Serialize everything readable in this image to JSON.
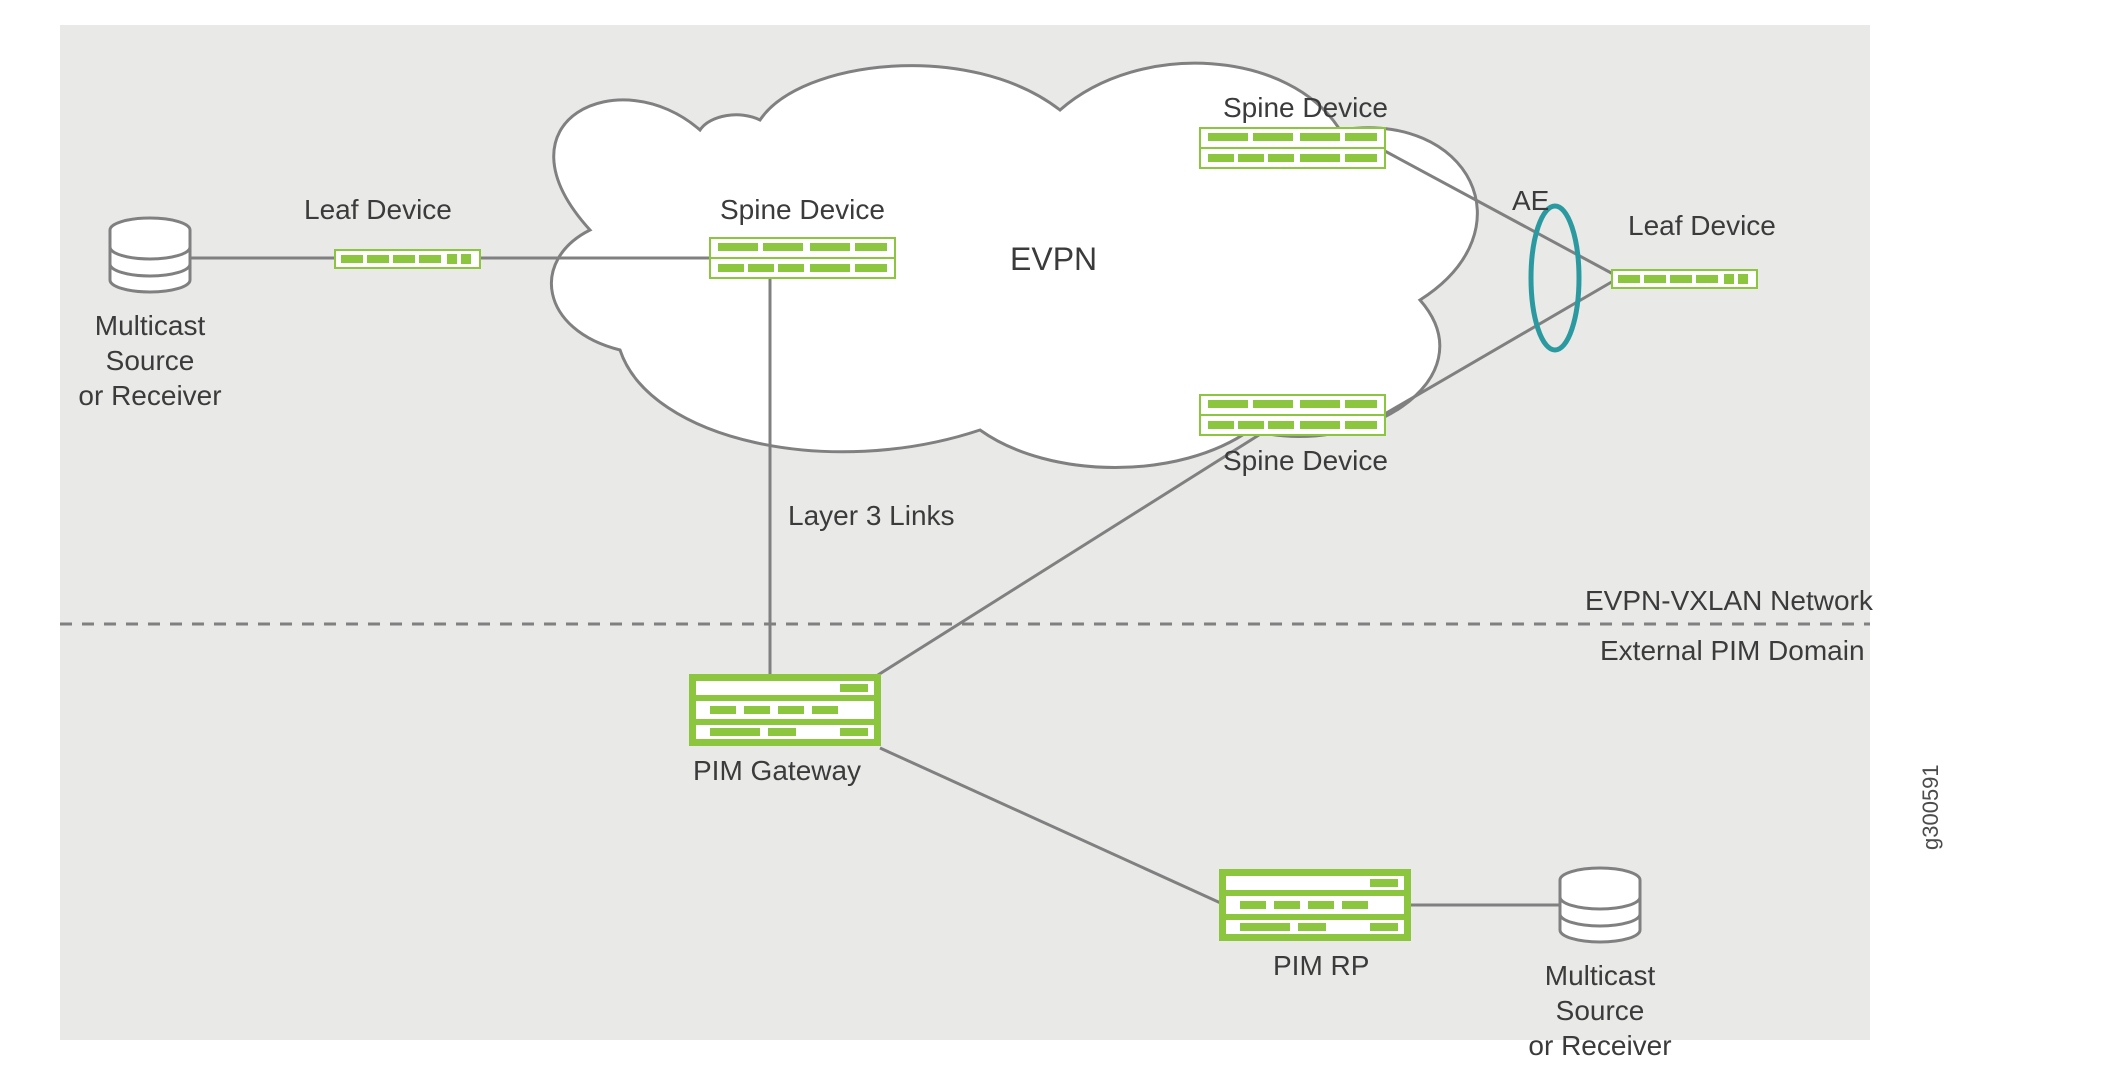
{
  "cloud_label": "EVPN",
  "upper_domain_label": "EVPN-VXLAN Network",
  "lower_domain_label": "External PIM Domain",
  "devices": {
    "leaf_left": "Leaf Device",
    "leaf_right": "Leaf Device",
    "spine_top": "Spine Device",
    "spine_left": "Spine Device",
    "spine_bottom": "Spine Device",
    "pim_gateway": "PIM Gateway",
    "pim_rp": "PIM RP"
  },
  "hosts": {
    "left": [
      "Multicast",
      "Source",
      "or Receiver"
    ],
    "right": [
      "Multicast",
      "Source",
      "or Receiver"
    ]
  },
  "annotations": {
    "ae": "AE",
    "l3_links": "Layer 3 Links"
  },
  "figure_id": "g300591",
  "colors": {
    "device_stroke": "#8cc63f",
    "device_fill_light": "#ffffff",
    "device_fill_bar": "#8cc63f",
    "link": "#808080",
    "text": "#3b3b3b",
    "ring": "#2a9aa0"
  }
}
